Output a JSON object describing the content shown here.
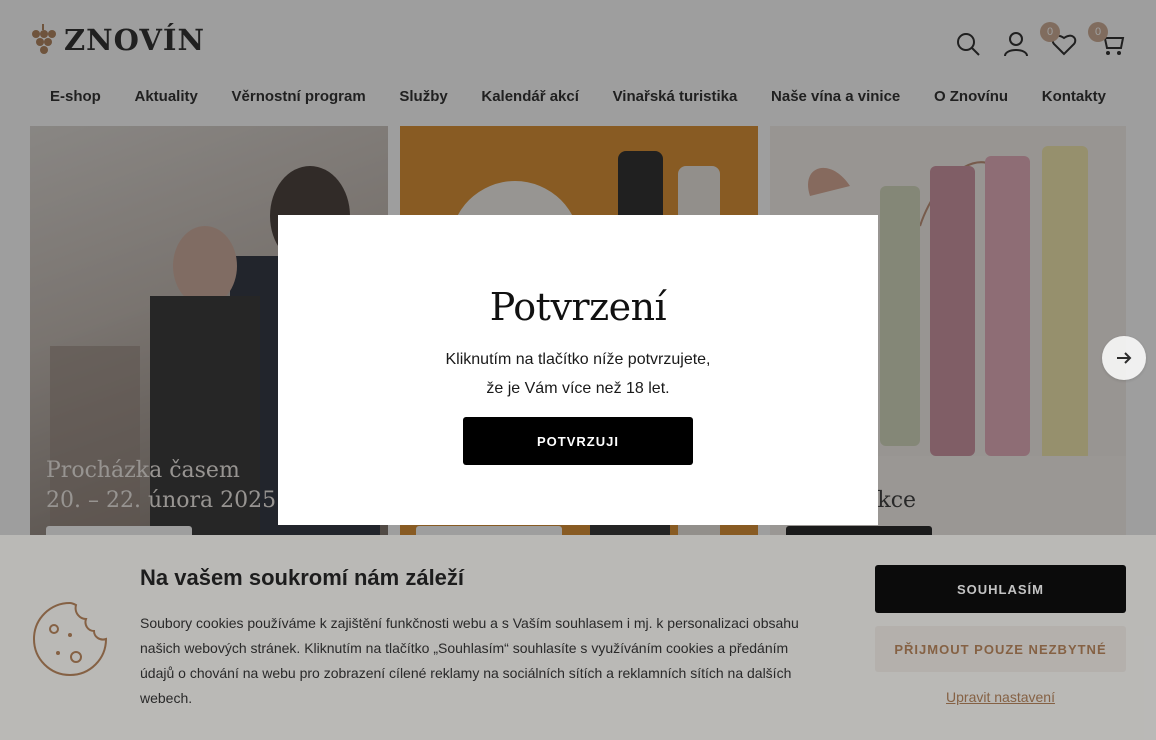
{
  "brand": {
    "name": "ZNOVÍN",
    "accent": "#a9784f"
  },
  "header": {
    "icons": [
      "search-icon",
      "user-icon",
      "heart-icon",
      "cart-icon"
    ],
    "wishlist_count": "0",
    "cart_count": "0"
  },
  "nav": {
    "items": [
      "E-shop",
      "Aktuality",
      "Věrnostní program",
      "Služby",
      "Kalendář akcí",
      "Vinařská turistika",
      "Naše vína a vinice",
      "O Znovínu",
      "Kontakty"
    ]
  },
  "slides": {
    "slide1": {
      "title_line1": "Procházka časem",
      "title_line2": "20. – 22. února 2025"
    },
    "slide3": {
      "title": "ská kolekce"
    }
  },
  "modal": {
    "title": "Potvrzení",
    "text_line1": "Kliknutím na tlačítko níže potvrzujete,",
    "text_line2": "že je Vám více než 18 let.",
    "confirm_label": "POTVRZUJI"
  },
  "cookie": {
    "title": "Na vašem soukromí nám záleží",
    "text": "Soubory cookies používáme k zajištění funkčnosti webu a s Vaším souhlasem i mj. k personalizaci obsahu našich webových stránek. Kliknutím na tlačítko „Souhlasím“ souhlasíte s využíváním cookies a předáním údajů o chování na webu pro zobrazení cílené reklamy na sociálních sítích a reklamních sítích na dalších webech.",
    "accept_label": "SOUHLASÍM",
    "necessary_label": "PŘIJMOUT POUZE NEZBYTNÉ",
    "settings_label": "Upravit nastavení"
  }
}
